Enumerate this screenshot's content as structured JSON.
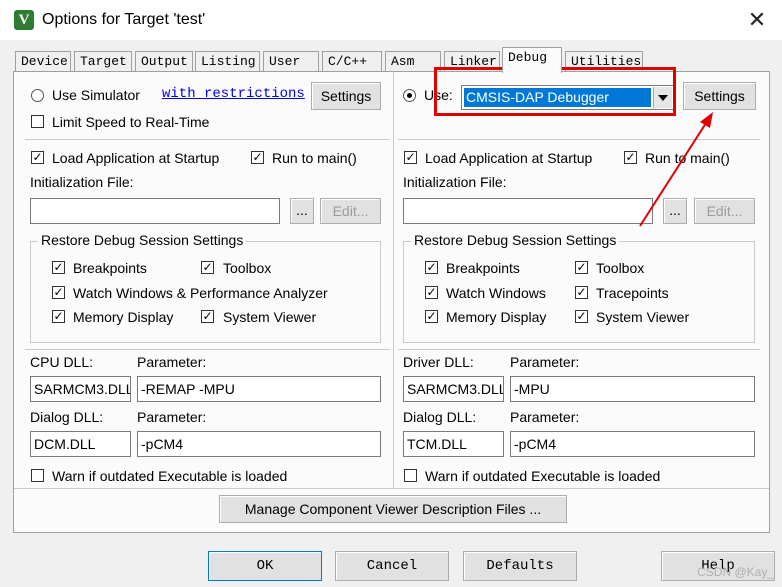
{
  "window": {
    "title": "Options for Target 'test'",
    "icon_letter": "V",
    "close_glyph": "✕"
  },
  "tabs": [
    "Device",
    "Target",
    "Output",
    "Listing",
    "User",
    "C/C++",
    "Asm",
    "Linker",
    "Debug",
    "Utilities"
  ],
  "active_tab": "Debug",
  "left": {
    "use_simulator": "Use Simulator",
    "with_restrictions": "with restrictions",
    "settings": "Settings",
    "limit_speed": "Limit Speed to Real-Time",
    "load_app": "Load Application at Startup",
    "run_to_main": "Run to main()",
    "init_file": "Initialization File:",
    "init_value": "",
    "browse": "...",
    "edit": "Edit...",
    "restore_title": "Restore Debug Session Settings",
    "breakpoints": "Breakpoints",
    "toolbox": "Toolbox",
    "watch_windows": "Watch Windows & Performance Analyzer",
    "memory_display": "Memory Display",
    "system_viewer": "System Viewer",
    "cpu_dll_label": "CPU DLL:",
    "cpu_param_label": "Parameter:",
    "cpu_dll": "SARMCM3.DLL",
    "cpu_param": "-REMAP -MPU",
    "dialog_dll_label": "Dialog DLL:",
    "dialog_param_label": "Parameter:",
    "dialog_dll": "DCM.DLL",
    "dialog_param": "-pCM4",
    "warn": "Warn if outdated Executable is loaded"
  },
  "right": {
    "use_label": "Use:",
    "debugger": "CMSIS-DAP Debugger",
    "settings": "Settings",
    "load_app": "Load Application at Startup",
    "run_to_main": "Run to main()",
    "init_file": "Initialization File:",
    "init_value": "",
    "browse": "...",
    "edit": "Edit...",
    "restore_title": "Restore Debug Session Settings",
    "breakpoints": "Breakpoints",
    "toolbox": "Toolbox",
    "watch_windows": "Watch Windows",
    "tracepoints": "Tracepoints",
    "memory_display": "Memory Display",
    "system_viewer": "System Viewer",
    "driver_dll_label": "Driver DLL:",
    "driver_param_label": "Parameter:",
    "driver_dll": "SARMCM3.DLL",
    "driver_param": "-MPU",
    "dialog_dll_label": "Dialog DLL:",
    "dialog_param_label": "Parameter:",
    "dialog_dll": "TCM.DLL",
    "dialog_param": "-pCM4",
    "warn": "Warn if outdated Executable is loaded"
  },
  "manage_button": "Manage Component Viewer Description Files ...",
  "footer": {
    "ok": "OK",
    "cancel": "Cancel",
    "defaults": "Defaults",
    "help": "Help"
  },
  "watermark": "CSDN @Kay_",
  "check_glyph": "✓",
  "colors": {
    "highlight_red": "#e00000",
    "selection_blue": "#0078d7",
    "link_blue": "#0000ee"
  }
}
